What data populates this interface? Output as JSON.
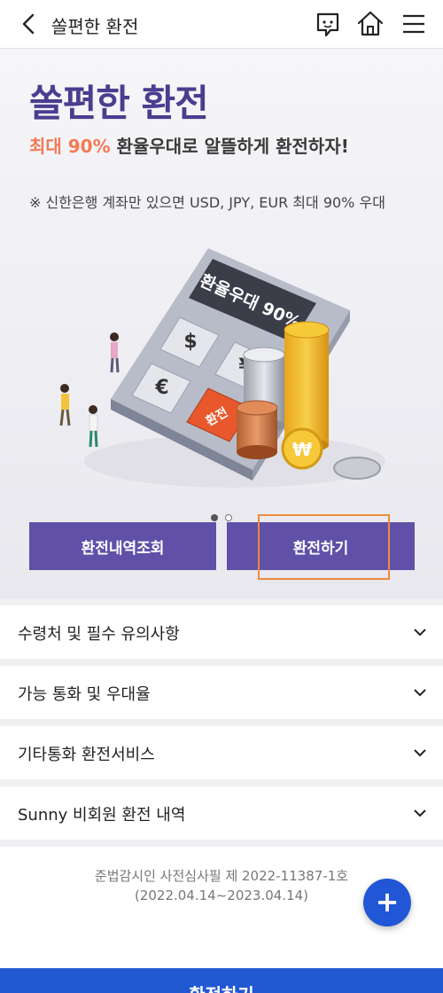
{
  "header": {
    "title": "쏠편한 환전",
    "icons": [
      "back-icon",
      "chat-icon",
      "home-icon",
      "menu-icon"
    ]
  },
  "hero": {
    "title": "쏠편한 환전",
    "subtitle_highlight": "최대 90%",
    "subtitle_rest": " 환율우대로 알뜰하게 환전하자!",
    "note": "※ 신한은행 계좌만 있으면 USD, JPY, EUR 최대 90% 우대",
    "calculator_screen": "환율우대 90%",
    "calc_keys": {
      "dollar": "$",
      "yen": "¥",
      "euro": "€",
      "exchange": "환전"
    },
    "coin_won": "₩",
    "carousel": {
      "total": 2,
      "active": 1
    }
  },
  "buttons": {
    "history": "환전내역조회",
    "exchange": "환전하기"
  },
  "accordion": [
    {
      "label": "수령처 및 필수 유의사항"
    },
    {
      "label": "가능 통화 및 우대율"
    },
    {
      "label": "기타통화 환전서비스"
    },
    {
      "label": "Sunny 비회원 환전 내역"
    }
  ],
  "footer": {
    "notice_line1": "준법감시인 사전심사필 제 2022-11387-1호",
    "notice_line2": "(2022.04.14~2023.04.14)",
    "fab_symbol": "+"
  },
  "bottom_bar": {
    "label": "환전하기"
  },
  "colors": {
    "brand_purple": "#6050a8",
    "title_purple": "#4b3d8f",
    "accent_orange": "#f27a54",
    "bottom_blue": "#2159d2",
    "focus_orange": "#f08a3c"
  }
}
